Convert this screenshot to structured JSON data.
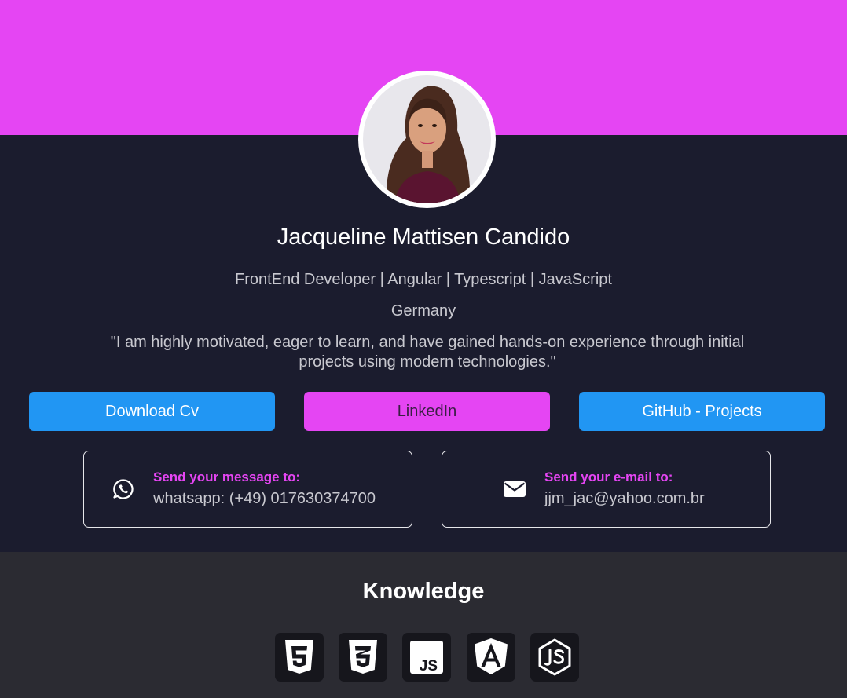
{
  "profile": {
    "name": "Jacqueline Mattisen Candido",
    "headline": "FrontEnd Developer | Angular | Typescript | JavaScript",
    "location": "Germany",
    "quote": "\"I am highly motivated, eager to learn, and have gained hands-on experience through initial projects using modern technologies.\""
  },
  "buttons": {
    "download_cv": "Download Cv",
    "linkedin": "LinkedIn",
    "github": "GitHub - Projects"
  },
  "contacts": {
    "whatsapp": {
      "title": "Send your message to:",
      "value": "whatsapp: (+49) 017630374700",
      "icon": "whatsapp-icon"
    },
    "email": {
      "title": "Send your e-mail to:",
      "value": "jjm_jac@yahoo.com.br",
      "icon": "envelope-icon"
    }
  },
  "knowledge": {
    "title": "Knowledge",
    "skills": [
      {
        "icon": "html5-icon"
      },
      {
        "icon": "css3-icon"
      },
      {
        "icon": "javascript-icon"
      },
      {
        "icon": "angular-icon"
      },
      {
        "icon": "nodejs-icon"
      }
    ]
  },
  "colors": {
    "banner": "#e545f3",
    "background": "#1b1c2e",
    "knowledge_background": "#2b2b32",
    "primary_button": "#2196f3",
    "accent": "#e545f3"
  }
}
